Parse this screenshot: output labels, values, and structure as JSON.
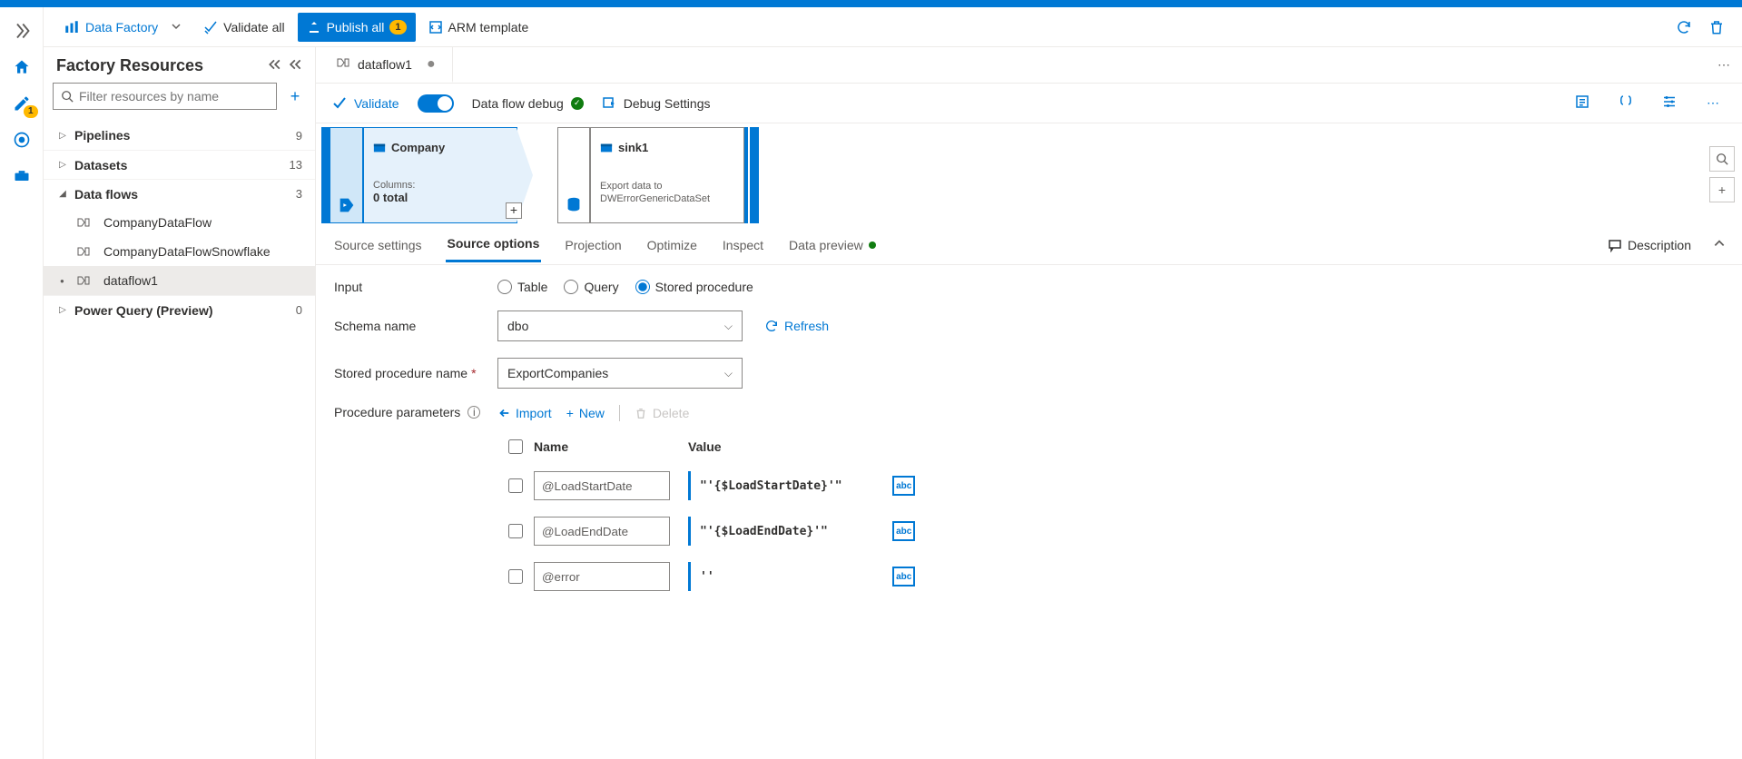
{
  "toolbar": {
    "data_factory": "Data Factory",
    "validate_all": "Validate all",
    "publish_all": "Publish all",
    "publish_badge": "1",
    "arm_template": "ARM template"
  },
  "rail": {
    "pencil_badge": "1"
  },
  "resources": {
    "title": "Factory Resources",
    "filter_placeholder": "Filter resources by name",
    "categories": [
      {
        "label": "Pipelines",
        "count": "9",
        "expanded": false
      },
      {
        "label": "Datasets",
        "count": "13",
        "expanded": false
      },
      {
        "label": "Data flows",
        "count": "3",
        "expanded": true
      },
      {
        "label": "Power Query (Preview)",
        "count": "0",
        "expanded": false
      }
    ],
    "dataflow_items": [
      {
        "label": "CompanyDataFlow",
        "active": false
      },
      {
        "label": "CompanyDataFlowSnowflake",
        "active": false
      },
      {
        "label": "dataflow1",
        "active": true
      }
    ]
  },
  "tab": {
    "name": "dataflow1"
  },
  "actionbar": {
    "validate": "Validate",
    "debug_label": "Data flow debug",
    "debug_settings": "Debug Settings"
  },
  "canvas": {
    "source": {
      "title": "Company",
      "sub1": "Columns:",
      "sub2": "0 total"
    },
    "sink": {
      "title": "sink1",
      "desc1": "Export data to",
      "desc2": "DWErrorGenericDataSet"
    }
  },
  "cfg_tabs": {
    "t0": "Source settings",
    "t1": "Source options",
    "t2": "Projection",
    "t3": "Optimize",
    "t4": "Inspect",
    "t5": "Data preview",
    "description": "Description"
  },
  "form": {
    "input_label": "Input",
    "input_options": {
      "table": "Table",
      "query": "Query",
      "sp": "Stored procedure"
    },
    "schema_label": "Schema name",
    "schema_value": "dbo",
    "refresh": "Refresh",
    "sp_label": "Stored procedure name",
    "sp_value": "ExportCompanies",
    "params_label": "Procedure parameters",
    "import": "Import",
    "new": "New",
    "delete": "Delete",
    "col_name": "Name",
    "col_value": "Value",
    "rows": [
      {
        "name": "@LoadStartDate",
        "value": "\"'{$LoadStartDate}'\""
      },
      {
        "name": "@LoadEndDate",
        "value": "\"'{$LoadEndDate}'\""
      },
      {
        "name": "@error",
        "value": "''"
      }
    ],
    "abc": "abc"
  }
}
